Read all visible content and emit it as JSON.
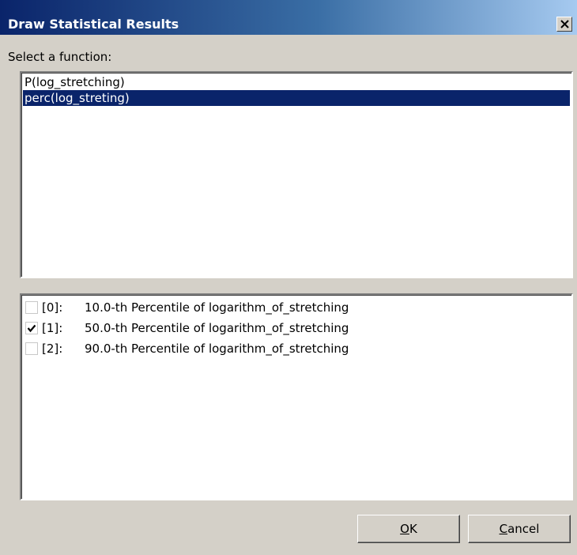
{
  "window": {
    "title": "Draw Statistical Results",
    "close_icon": "close-icon"
  },
  "prompt": "Select a function:",
  "functions": {
    "items": [
      {
        "label": "P(log_stretching)",
        "selected": false
      },
      {
        "label": "perc(log_streting)",
        "selected": true
      }
    ]
  },
  "percentiles": {
    "items": [
      {
        "index": "[0]:",
        "label": "10.0-th Percentile of logarithm_of_stretching",
        "checked": false
      },
      {
        "index": "[1]:",
        "label": "50.0-th Percentile of logarithm_of_stretching",
        "checked": true
      },
      {
        "index": "[2]:",
        "label": "90.0-th Percentile of logarithm_of_stretching",
        "checked": false
      }
    ]
  },
  "buttons": {
    "ok": {
      "mnemonic": "O",
      "rest": "K"
    },
    "cancel": {
      "mnemonic": "C",
      "rest": "ancel"
    }
  },
  "colors": {
    "selection": "#0a246a",
    "titlebar_start": "#0a246a",
    "titlebar_end": "#a6caf0",
    "face": "#d4d0c8"
  }
}
